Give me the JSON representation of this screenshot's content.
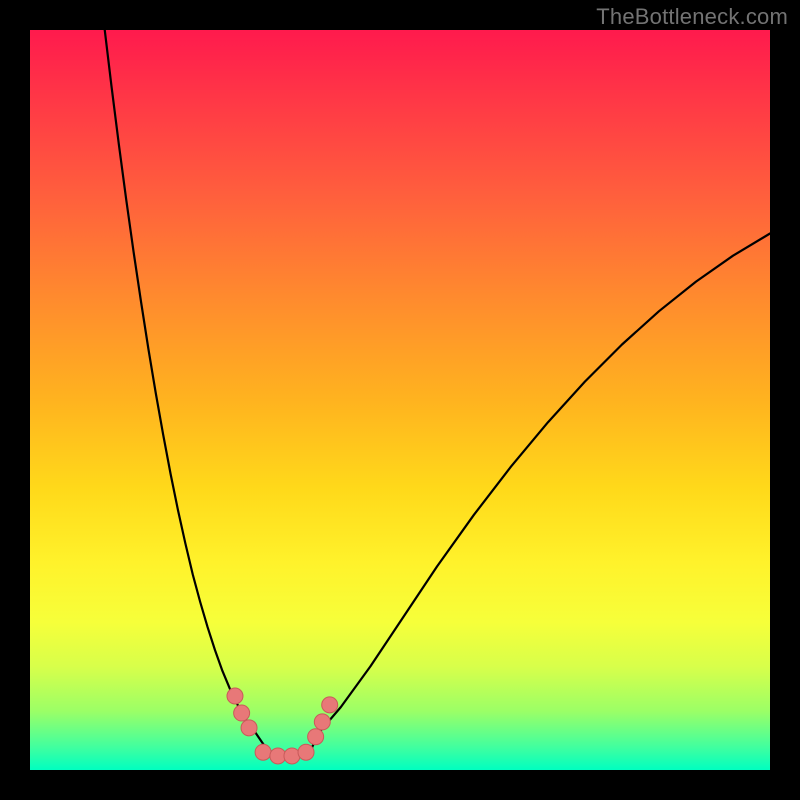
{
  "watermark": "TheBottleneck.com",
  "colors": {
    "curve_stroke": "#000000",
    "marker_fill": "#e87878",
    "marker_stroke": "#c95a5a",
    "background_black": "#000000"
  },
  "chart_data": {
    "type": "line",
    "title": "",
    "xlabel": "",
    "ylabel": "",
    "xlim": [
      0,
      100
    ],
    "ylim": [
      0,
      100
    ],
    "series": [
      {
        "name": "left-branch",
        "x": [
          10.1,
          11.0,
          12.0,
          13.0,
          14.0,
          15.0,
          16.0,
          17.0,
          18.0,
          19.0,
          20.0,
          21.0,
          22.0,
          23.0,
          24.0,
          25.0,
          26.0,
          27.0,
          28.0,
          29.0,
          30.0,
          30.5
        ],
        "y": [
          100.0,
          92.5,
          84.6,
          77.1,
          70.0,
          63.3,
          56.9,
          50.9,
          45.3,
          40.0,
          35.1,
          30.6,
          26.4,
          22.7,
          19.3,
          16.2,
          13.4,
          11.0,
          8.9,
          7.1,
          5.6,
          5.0
        ]
      },
      {
        "name": "valley-floor",
        "x": [
          30.5,
          32.0,
          34.0,
          36.0,
          38.0,
          39.0
        ],
        "y": [
          5.0,
          2.8,
          1.7,
          1.7,
          2.8,
          5.0
        ]
      },
      {
        "name": "right-branch",
        "x": [
          39.0,
          42.0,
          46.0,
          50.0,
          55.0,
          60.0,
          65.0,
          70.0,
          75.0,
          80.0,
          85.0,
          90.0,
          95.0,
          100.0
        ],
        "y": [
          5.0,
          8.5,
          14.0,
          20.0,
          27.5,
          34.5,
          41.0,
          47.0,
          52.5,
          57.5,
          62.0,
          66.0,
          69.5,
          72.5
        ]
      }
    ],
    "markers": {
      "name": "data-points",
      "x": [
        27.7,
        28.6,
        29.6,
        31.5,
        33.5,
        35.4,
        37.3,
        38.6,
        39.5,
        40.5
      ],
      "y": [
        10.0,
        7.7,
        5.7,
        2.4,
        1.9,
        1.9,
        2.4,
        4.5,
        6.5,
        8.8
      ],
      "radius_px": 8
    }
  }
}
